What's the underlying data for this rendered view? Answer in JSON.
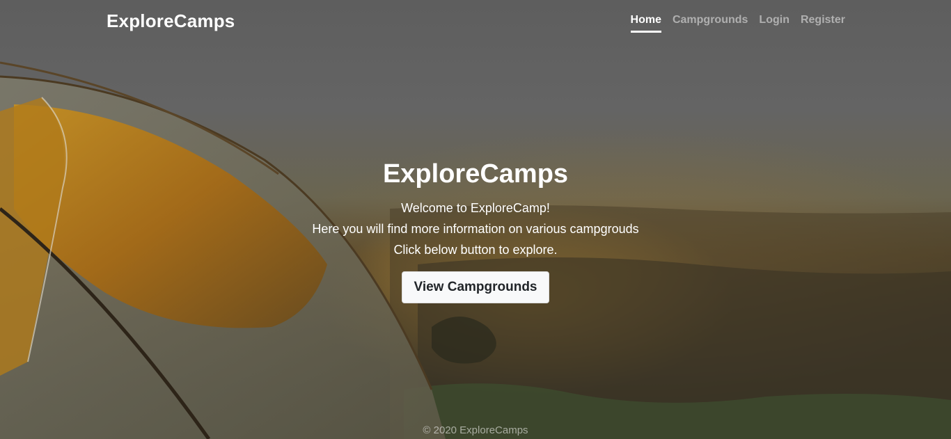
{
  "brand": "ExploreCamps",
  "nav": {
    "items": [
      {
        "label": "Home",
        "active": true
      },
      {
        "label": "Campgrounds",
        "active": false
      },
      {
        "label": "Login",
        "active": false
      },
      {
        "label": "Register",
        "active": false
      }
    ]
  },
  "hero": {
    "title": "ExploreCamps",
    "lines": [
      "Welcome to ExploreCamp!",
      "Here you will find more information on various campgrouds",
      "Click below button to explore."
    ],
    "button_label": "View Campgrounds"
  },
  "footer": {
    "text": "© 2020 ExploreCamps"
  },
  "colors": {
    "text": "#ffffff",
    "nav_inactive": "rgba(255,255,255,0.5)",
    "button_bg": "#f8f9fa",
    "button_text": "#212529"
  }
}
